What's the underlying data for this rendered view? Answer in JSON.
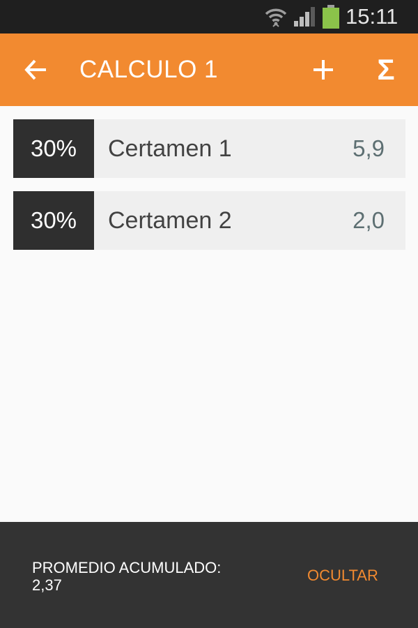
{
  "status_bar": {
    "time": "15:11",
    "battery_color": "#8bc34a"
  },
  "action_bar": {
    "title": "CALCULO 1",
    "color": "#f28a30",
    "icons": [
      "back-arrow-icon",
      "add-icon",
      "sum-icon"
    ],
    "sum_symbol": "Σ"
  },
  "grades": [
    {
      "weight": "30%",
      "name": "Certamen 1",
      "grade": "5,9"
    },
    {
      "weight": "30%",
      "name": "Certamen 2",
      "grade": "2,0"
    }
  ],
  "summary": {
    "label": "PROMEDIO ACUMULADO:",
    "value": "2,37",
    "hide_label": "OCULTAR"
  }
}
